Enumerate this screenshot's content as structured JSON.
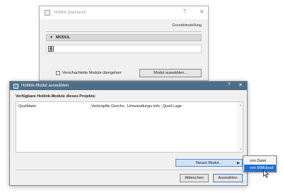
{
  "background_dialog": {
    "title": "Hotlink platzieren",
    "help_glyph": "?",
    "close_glyph": "✕",
    "settings_label": "Grundeinstellung",
    "section_title": "MODUL",
    "nested_checkbox_label": "Verschachtelte Module übergehen",
    "nested_checked": false,
    "select_module_button": "Modul auswählen..."
  },
  "dialog": {
    "title": "Hotlink-Modul auswählen",
    "help_glyph": "?",
    "close_glyph": "✕",
    "heading": "Verfügbare Hotlink-Module dieses Projekts:",
    "columns": [
      "Quelldatei",
      "Verknüpfte Gescho",
      "Umwandlungs-Info",
      "Quell-Lage"
    ],
    "new_module_button": "Neues Modul...",
    "cancel_button": "Abbrechen",
    "select_button": "Auswählen"
  },
  "submenu": {
    "items": [
      "von Datei",
      "von BIMcloud"
    ],
    "highlighted_index": 1
  },
  "colors": {
    "titlebar": "#4e6e87",
    "menu_highlight": "#1f6fd1",
    "button_focus": "#cfe3f5"
  }
}
